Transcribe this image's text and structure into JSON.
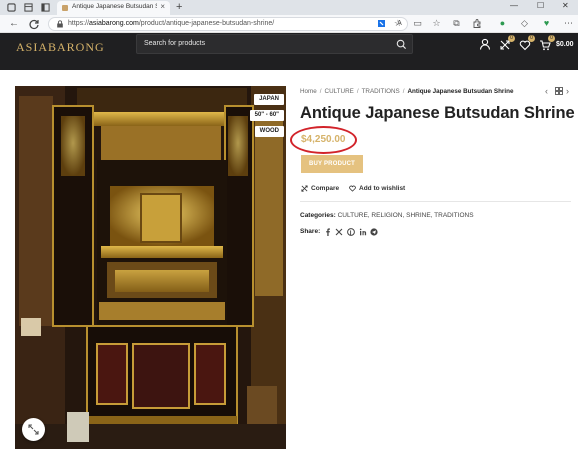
{
  "browser": {
    "tab_title": "Antique Japanese Butsudan Shrine",
    "url_host": "asiabarong.com",
    "url_prefix": "https://",
    "url_path": "/product/antique-japanese-butsudan-shrine/"
  },
  "site": {
    "logo": "ASIABARONG",
    "search_placeholder": "Search for products",
    "compare_count": "0",
    "wishlist_count": "0",
    "cart_count": "0",
    "cart_total": "$0.00",
    "accent_color": "#d6b36a",
    "header_color": "#1f1f21"
  },
  "gallery": {
    "tags": [
      "JAPAN",
      "50\" - 60\"",
      "WOOD"
    ]
  },
  "breadcrumb": {
    "home": "Home",
    "items": [
      "CULTURE",
      "TRADITIONS"
    ],
    "current": "Antique Japanese Butsudan Shrine",
    "separator": "/"
  },
  "product": {
    "title": "Antique Japanese Butsudan Shrine",
    "price": "$4,250.00",
    "buy_label": "BUY PRODUCT",
    "compare_label": "Compare",
    "wishlist_label": "Add to wishlist",
    "categories_label": "Categories:",
    "categories": [
      "CULTURE",
      "RELIGION",
      "SHRINE",
      "TRADITIONS"
    ],
    "share_label": "Share:",
    "share_icons": [
      "facebook-icon",
      "x-icon",
      "pinterest-icon",
      "linkedin-icon",
      "telegram-icon"
    ]
  },
  "annotation": {
    "color": "#d2232a",
    "shape": "ellipse around price"
  }
}
